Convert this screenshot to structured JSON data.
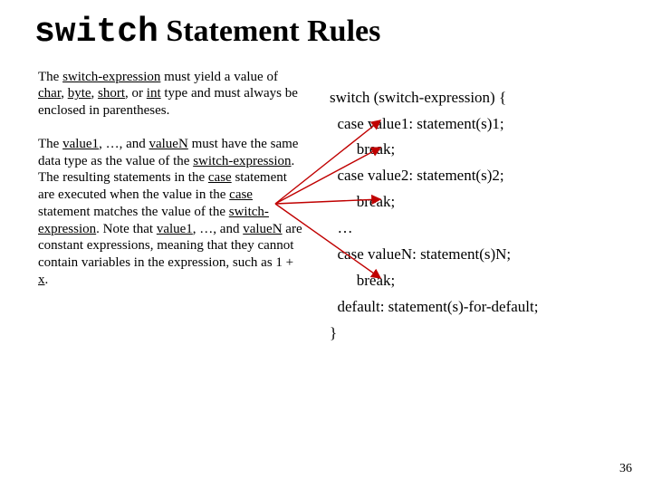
{
  "title": {
    "code": "switch",
    "rest": " Statement Rules"
  },
  "left": {
    "p1": {
      "t1": "The ",
      "u1": "switch-expression",
      "t2": " must yield a value of ",
      "u2": "char",
      "t3": ", ",
      "u3": "byte",
      "t4": ", ",
      "u4": "short",
      "t5": ", or ",
      "u5": "int",
      "t6": " type and must always be enclosed in parentheses."
    },
    "p2": {
      "t1": "The ",
      "u1": "value1",
      "t2": ", …, and ",
      "u2": "valueN",
      "t3": " must have the same data type as the value of the ",
      "u3": "switch-expression",
      "t4": ". The resulting statements in the ",
      "u4": "case",
      "t5": " statement are executed when the value in the ",
      "u5": "case",
      "t6": " statement matches the value of the ",
      "u6": "switch-expression",
      "t7": ". Note that ",
      "u7": "value1",
      "t8": ", …, and ",
      "u8": "valueN",
      "t9": " are constant expressions, meaning that they cannot contain variables in the expression, such as 1 + ",
      "u9": "x",
      "t10": "."
    }
  },
  "code": {
    "l1": "switch (switch-expression) {",
    "l2": "  case value1: statement(s)1;",
    "l3": "       break;",
    "l4": "  case value2: statement(s)2;",
    "l5": "       break;",
    "l6": "  …",
    "l7": "  case valueN: statement(s)N;",
    "l8": "       break;",
    "l9": "  default: statement(s)-for-default;",
    "l10": "}"
  },
  "page": "36"
}
